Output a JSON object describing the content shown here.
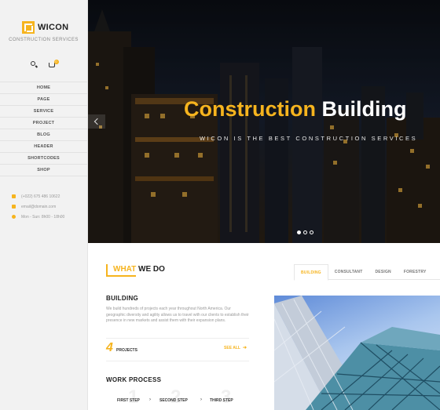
{
  "sidebar": {
    "logo_text": "WICON",
    "tagline": "CONSTRUCTION SERVICES",
    "cart_count": "0",
    "nav": [
      "HOME",
      "PAGE",
      "SERVICE",
      "PROJECT",
      "BLOG",
      "HEADER",
      "SHORTCODES",
      "SHOP"
    ],
    "contact": {
      "phone": "(+022) 675 486 10622",
      "email": "email@domain.com",
      "hours": "Mon - Sun: 8h00 - 18h00"
    }
  },
  "hero": {
    "title_highlight": "Construction",
    "title_rest": "Building",
    "subtitle": "WICON IS THE BEST CONSTRUCTION SERVICES",
    "slide_count": 3,
    "active_slide": 1
  },
  "what_we_do": {
    "title_highlight": "WHAT",
    "title_rest": "WE DO",
    "tabs": [
      "BUILDING",
      "CONSULTANT",
      "DESIGN",
      "FORESTRY"
    ],
    "active_tab": "BUILDING",
    "building": {
      "heading": "BUILDING",
      "text": "We build hundreds of projects each year throughout North America. Our geographic diversity and agility allows us to travel with our clients to establish their presence in new markets and assist them with their expansion plans.",
      "stat_number": "4",
      "stat_label": "PROJECTS",
      "see_all": "SEE ALL"
    },
    "work_process": {
      "heading": "WORK PROCESS",
      "steps": [
        {
          "ghost": "1",
          "label": "FIRST STEP"
        },
        {
          "ghost": "2",
          "label": "SECOND STEP"
        },
        {
          "ghost": "3",
          "label": "THIRD STEP"
        }
      ]
    }
  },
  "colors": {
    "accent": "#f6b41e",
    "sidebar_bg": "#f2f2f2",
    "text_dark": "#222222"
  }
}
